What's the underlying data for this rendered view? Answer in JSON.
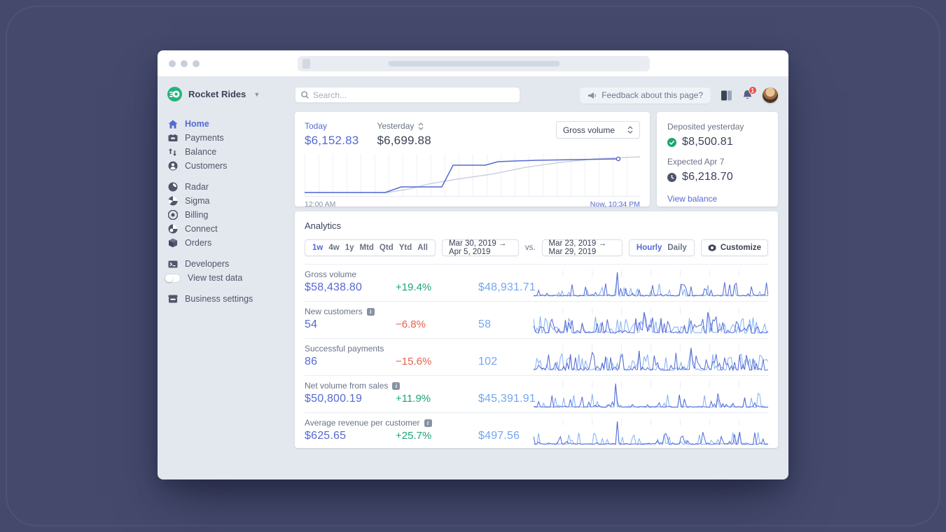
{
  "window": {
    "traffic_lights": 3
  },
  "sidebar": {
    "brand": "Rocket Rides",
    "groups": [
      {
        "items": [
          {
            "label": "Home",
            "icon": "home-icon",
            "active": true
          },
          {
            "label": "Payments",
            "icon": "payments-icon"
          },
          {
            "label": "Balance",
            "icon": "balance-icon"
          },
          {
            "label": "Customers",
            "icon": "customers-icon"
          }
        ]
      },
      {
        "items": [
          {
            "label": "Radar",
            "icon": "radar-icon"
          },
          {
            "label": "Sigma",
            "icon": "sigma-icon"
          },
          {
            "label": "Billing",
            "icon": "billing-icon"
          },
          {
            "label": "Connect",
            "icon": "connect-icon"
          },
          {
            "label": "Orders",
            "icon": "orders-icon"
          }
        ]
      },
      {
        "items": [
          {
            "label": "Developers",
            "icon": "developers-icon"
          },
          {
            "label": "View test data",
            "icon": "toggle"
          }
        ]
      },
      {
        "items": [
          {
            "label": "Business settings",
            "icon": "business-settings-icon"
          }
        ]
      }
    ]
  },
  "topbar": {
    "search_placeholder": "Search...",
    "feedback_label": "Feedback about this page?",
    "notification_count": "1"
  },
  "today_panel": {
    "today_label": "Today",
    "today_value": "$6,152.83",
    "yesterday_label": "Yesterday",
    "yesterday_value": "$6,699.88",
    "metric_select_value": "Gross volume",
    "x_start": "12:00 AM",
    "x_end": "Now, 10:34 PM"
  },
  "balance_panel": {
    "deposited_label": "Deposited yesterday",
    "deposited_value": "$8,500.81",
    "expected_label": "Expected Apr 7",
    "expected_value": "$6,218.70",
    "link_label": "View balance"
  },
  "analytics": {
    "title": "Analytics",
    "ranges": [
      "1w",
      "4w",
      "1y",
      "Mtd",
      "Qtd",
      "Ytd",
      "All"
    ],
    "active_range": "1w",
    "date_range_current": "Mar 30, 2019 →  Apr 5, 2019",
    "vs_label": "vs.",
    "date_range_previous": "Mar 23, 2019 → Mar 29, 2019",
    "granularity_hourly": "Hourly",
    "granularity_daily": "Daily",
    "customize_label": "Customize",
    "rows": [
      {
        "label": "Gross volume",
        "current": "$58,438.80",
        "delta": "+19.4%",
        "delta_class": "m-delta up",
        "previous": "$48,931.71",
        "has_info": false
      },
      {
        "label": "New customers",
        "current": "54",
        "delta": "−6.8%",
        "delta_class": "m-delta down",
        "previous": "58",
        "has_info": true
      },
      {
        "label": "Successful payments",
        "current": "86",
        "delta": "−15.6%",
        "delta_class": "m-delta down",
        "previous": "102",
        "has_info": false
      },
      {
        "label": "Net volume from sales",
        "current": "$50,800.19",
        "delta": "+11.9%",
        "delta_class": "m-delta up",
        "previous": "$45,391.91",
        "has_info": true
      },
      {
        "label": "Average revenue per customer",
        "current": "$625.65",
        "delta": "+25.7%",
        "delta_class": "m-delta up",
        "previous": "$497.56",
        "has_info": true
      }
    ]
  },
  "colors": {
    "accent_blurple": "#5469d4",
    "comparison_blue": "#74a7f3",
    "positive_green": "#1ea672",
    "negative_red": "#e8604c",
    "brand_green": "#23b47e",
    "backdrop": "#454a6d",
    "dashboard_bg": "#e3e8ee"
  }
}
